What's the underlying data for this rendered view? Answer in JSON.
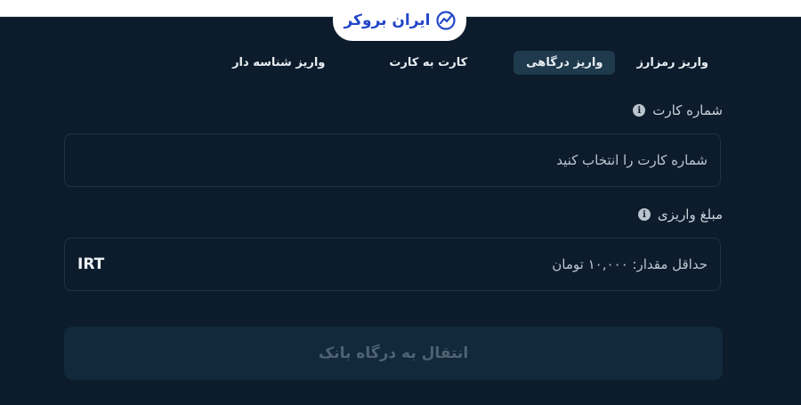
{
  "brand": {
    "name": "ایران بروکر",
    "icon": "chart-trend-icon",
    "color": "#2346c8"
  },
  "tabs": [
    {
      "label": "واریز رمزارز",
      "active": false
    },
    {
      "label": "واریز درگاهی",
      "active": true
    },
    {
      "label": "کارت به کارت",
      "active": false
    },
    {
      "label": "واریز شناسه دار",
      "active": false
    }
  ],
  "card_field": {
    "label": "شماره کارت",
    "placeholder": "شماره کارت را انتخاب کنید",
    "icon": "info-icon"
  },
  "amount_field": {
    "label": "مبلغ واریزی",
    "placeholder": "حداقل مقدار: ۱۰,۰۰۰ تومان",
    "unit": "IRT",
    "icon": "info-icon"
  },
  "submit": {
    "label": "انتقال به درگاه بانک",
    "enabled": false
  },
  "colors": {
    "background": "#0c1c2c",
    "active_tab": "#1e3a4c",
    "button_bg": "#12293b",
    "button_text": "#4e6272"
  }
}
